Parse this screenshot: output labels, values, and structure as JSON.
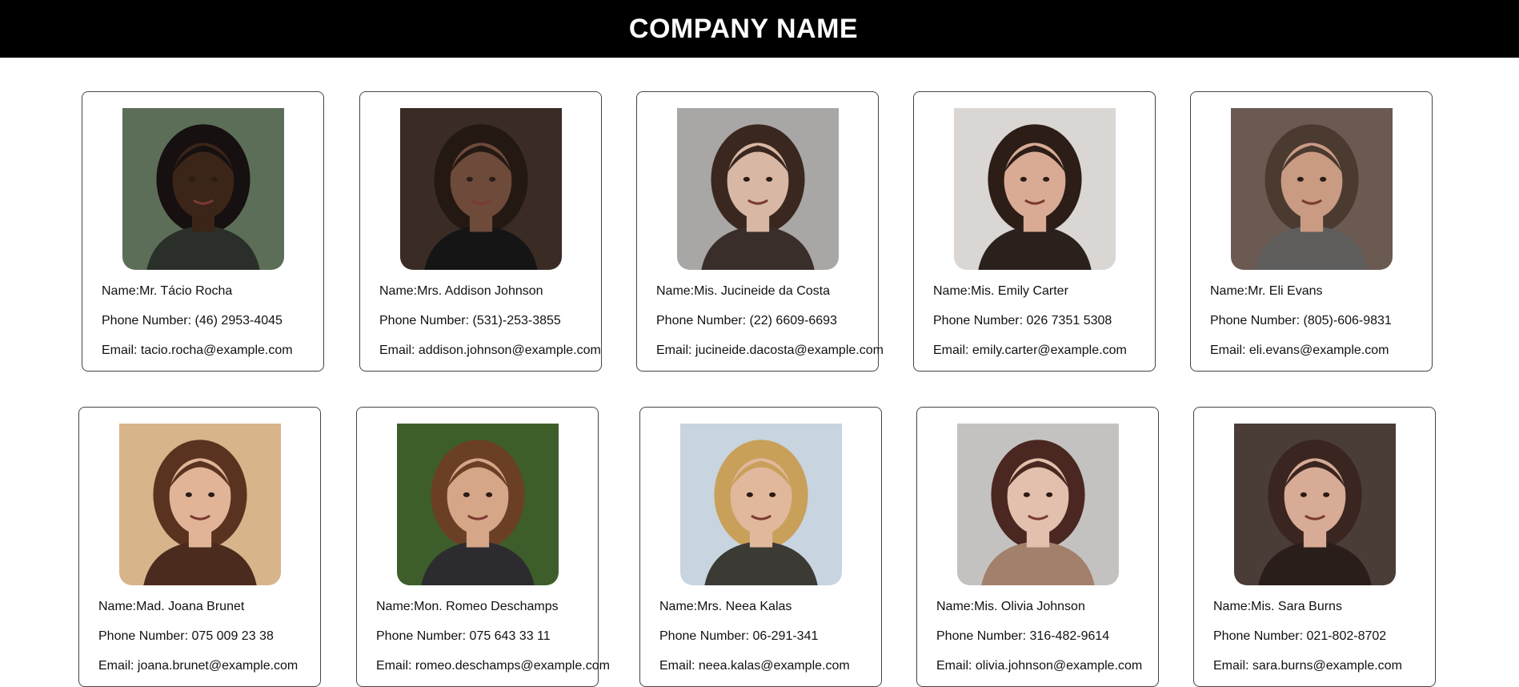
{
  "header": {
    "title": "COMPANY NAME"
  },
  "labels": {
    "name": "Name:",
    "phone": "Phone Number: ",
    "email": "Email: "
  },
  "people": [
    {
      "name": "Mr. Tácio Rocha",
      "phone": "(46) 2953-4045",
      "email": "tacio.rocha@example.com",
      "bg": "#5d6e58",
      "skin": "#3b2418",
      "hair": "#161010",
      "shirt": "#2b2f2a"
    },
    {
      "name": "Mrs. Addison Johnson",
      "phone": "(531)-253-3855",
      "email": "addison.johnson@example.com",
      "bg": "#3a2b24",
      "skin": "#6e4a3a",
      "hair": "#241813",
      "shirt": "#151515"
    },
    {
      "name": "Mis. Jucineide da Costa",
      "phone": "(22) 6609-6693",
      "email": "jucineide.dacosta@example.com",
      "bg": "#a9a7a6",
      "skin": "#d8b8a4",
      "hair": "#3a2820",
      "shirt": "#3a2e2b"
    },
    {
      "name": "Mis. Emily Carter",
      "phone": "026 7351 5308",
      "email": "emily.carter@example.com",
      "bg": "#d9d6d4",
      "skin": "#d9ab95",
      "hair": "#2c1d17",
      "shirt": "#2a201c"
    },
    {
      "name": "Mr. Eli Evans",
      "phone": "(805)-606-9831",
      "email": "eli.evans@example.com",
      "bg": "#6b5a52",
      "skin": "#c99b82",
      "hair": "#4a3a30",
      "shirt": "#5e5d5c"
    },
    {
      "name": "Mad. Joana Brunet",
      "phone": "075 009 23 38",
      "email": "joana.brunet@example.com",
      "bg": "#d8b48a",
      "skin": "#e1b498",
      "hair": "#5a3320",
      "shirt": "#4a2b1e"
    },
    {
      "name": "Mon. Romeo Deschamps",
      "phone": "075 643 33 11",
      "email": "romeo.deschamps@example.com",
      "bg": "#3d5e2a",
      "skin": "#d6a688",
      "hair": "#6a3f25",
      "shirt": "#2c2c30"
    },
    {
      "name": "Mrs. Neea Kalas",
      "phone": "06-291-341",
      "email": "neea.kalas@example.com",
      "bg": "#c8d4df",
      "skin": "#e2b89c",
      "hair": "#c9a05a",
      "shirt": "#3b3a34"
    },
    {
      "name": "Mis. Olivia Johnson",
      "phone": "316-482-9614",
      "email": "olivia.johnson@example.com",
      "bg": "#c4c2c0",
      "skin": "#e3c0ad",
      "hair": "#4a2720",
      "shirt": "#a3806b"
    },
    {
      "name": "Mis. Sara Burns",
      "phone": "021-802-8702",
      "email": "sara.burns@example.com",
      "bg": "#4a3c36",
      "skin": "#d7ab96",
      "hair": "#3a2520",
      "shirt": "#2a1e1a"
    }
  ]
}
